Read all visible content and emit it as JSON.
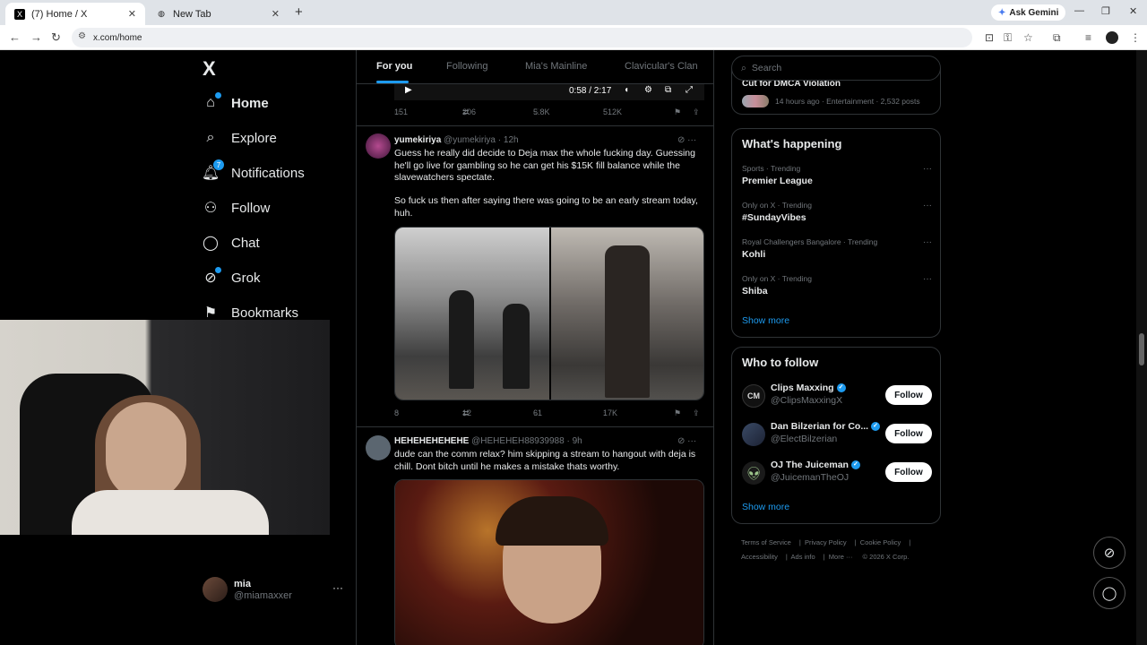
{
  "browser": {
    "tabs": [
      {
        "title": "(7) Home / X",
        "favicon": "X"
      },
      {
        "title": "New Tab"
      }
    ],
    "url": "x.com/home",
    "gemini_label": "Ask Gemini"
  },
  "sidebar": {
    "logo": "X",
    "items": [
      {
        "label": "Home",
        "icon": "home-icon"
      },
      {
        "label": "Explore",
        "icon": "search-icon"
      },
      {
        "label": "Notifications",
        "icon": "bell-icon",
        "badge": "7"
      },
      {
        "label": "Follow",
        "icon": "person-add-icon"
      },
      {
        "label": "Chat",
        "icon": "chat-icon"
      },
      {
        "label": "Grok",
        "icon": "grok-icon"
      },
      {
        "label": "Bookmarks",
        "icon": "bookmark-icon"
      }
    ],
    "user": {
      "name": "mia",
      "handle": "@miamaxxer"
    }
  },
  "feed": {
    "tabs": [
      "For you",
      "Following",
      "Mia's Mainline",
      "Clavicular's Clan"
    ],
    "player_time": "0:58 / 2:17",
    "first_actions": {
      "replies": "151",
      "reposts": "206",
      "likes": "5.8K",
      "views": "512K"
    },
    "posts": [
      {
        "name": "yumekiriya",
        "handle": "@yumekiriya",
        "time": "· 12h",
        "text1": "Guess he really did decide to Deja max the whole fucking day. Guessing he'll go live for gambling so he can get his $15K fill balance while the slavewatchers spectate.",
        "text2": "So fuck us then after saying there was going to be an early stream today, huh.",
        "actions": {
          "replies": "8",
          "reposts": "12",
          "likes": "61",
          "views": "17K"
        }
      },
      {
        "name": "HEHEHEHEHEHE",
        "handle": "@HEHEHEH88939988",
        "time": "· 9h",
        "text1": "dude can the comm relax? him skipping a stream to hangout with deja is chill. Dont bitch until he makes a mistake thats worthy."
      }
    ]
  },
  "right": {
    "search_placeholder": "Search",
    "top_card": {
      "title": "Cut for DMCA Violation",
      "meta": "14 hours ago · Entertainment · 2,532 posts"
    },
    "happening_title": "What's happening",
    "trends": [
      {
        "meta": "Sports · Trending",
        "title": "Premier League"
      },
      {
        "meta": "Only on X · Trending",
        "title": "#SundayVibes"
      },
      {
        "meta": "Royal Challengers Bangalore · Trending",
        "title": "Kohli"
      },
      {
        "meta": "Only on X · Trending",
        "title": "Shiba"
      }
    ],
    "show_more": "Show more",
    "wtf_title": "Who to follow",
    "who_to_follow": [
      {
        "name": "Clips Maxxing",
        "handle": "@ClipsMaxxingX",
        "avatar_text": "CM"
      },
      {
        "name": "Dan Bilzerian for Co...",
        "handle": "@ElectBilzerian"
      },
      {
        "name": "OJ The Juiceman",
        "handle": "@JuicemanTheOJ"
      }
    ],
    "follow_label": "Follow",
    "footer": [
      "Terms of Service",
      "Privacy Policy",
      "Cookie Policy",
      "Accessibility",
      "Ads info",
      "More ···",
      "© 2026 X Corp."
    ]
  }
}
